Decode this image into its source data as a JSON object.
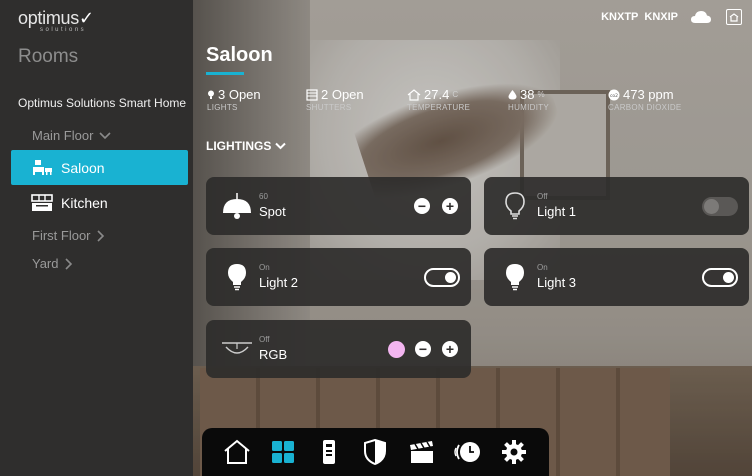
{
  "logo": {
    "text": "optimus",
    "subtext": "solutions"
  },
  "sidebar": {
    "title": "Rooms",
    "home_name": "Optimus Solutions Smart Home",
    "floors": [
      {
        "label": "Main Floor",
        "chevron": "chevron-down-icon"
      },
      {
        "label": "First Floor",
        "chevron": "chevron-right-icon"
      },
      {
        "label": "Yard",
        "chevron": "chevron-right-icon"
      }
    ],
    "rooms": [
      {
        "label": "Saloon",
        "icon": "sofa-icon",
        "active": true
      },
      {
        "label": "Kitchen",
        "icon": "kitchen-icon",
        "active": false
      }
    ]
  },
  "topbar": {
    "knx_tp": "KNXTP",
    "knx_ip": "KNXIP",
    "cloud_icon": "cloud-icon",
    "home_icon": "home-screen-icon"
  },
  "room": {
    "title": "Saloon"
  },
  "stats": [
    {
      "value": "3 Open",
      "unit": "",
      "label": "LIGHTS",
      "icon": "bulb-icon"
    },
    {
      "value": "2 Open",
      "unit": "",
      "label": "SHUTTERS",
      "icon": "shutter-icon"
    },
    {
      "value": "27.4",
      "unit": "C",
      "label": "TEMPERATURE",
      "icon": "house-temp-icon"
    },
    {
      "value": "38",
      "unit": "%",
      "label": "HUMIDITY",
      "icon": "drop-icon"
    },
    {
      "value": "473 ppm",
      "unit": "",
      "label": "CARBON DIOXIDE",
      "icon": "co2-icon"
    }
  ],
  "section": {
    "label": "LIGHTINGS"
  },
  "devices": [
    {
      "state": "60",
      "name": "Spot",
      "icon": "spot-lamp-icon",
      "control": "dimmer"
    },
    {
      "state": "Off",
      "name": "Light 1",
      "icon": "bulb-outline-icon",
      "control": "toggle",
      "on": false
    },
    {
      "state": "On",
      "name": "Light 2",
      "icon": "bulb-filled-icon",
      "control": "toggle",
      "on": true
    },
    {
      "state": "On",
      "name": "Light 3",
      "icon": "bulb-filled-icon",
      "control": "toggle",
      "on": true
    },
    {
      "state": "Off",
      "name": "RGB",
      "icon": "rgb-lamp-icon",
      "control": "rgb-dimmer",
      "color": "#f3b5f0"
    }
  ],
  "bottom_nav": [
    "home-icon",
    "rooms-grid-icon",
    "remote-icon",
    "security-shield-icon",
    "scenes-clapper-icon",
    "schedule-clock-icon",
    "settings-gear-icon"
  ],
  "colors": {
    "accent": "#19b2d2",
    "sidebar": "#2f2e2d",
    "card": "#2e2c2b"
  }
}
